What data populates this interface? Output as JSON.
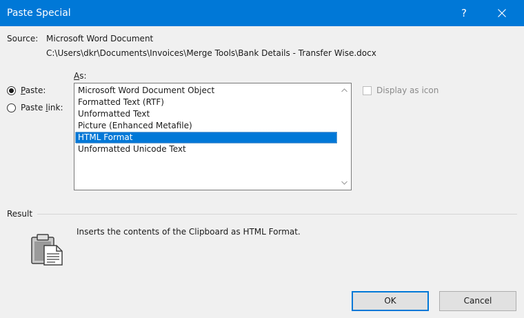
{
  "window": {
    "title": "Paste Special",
    "help_label": "?"
  },
  "source": {
    "label": "Source:",
    "value": "Microsoft Word Document",
    "path": "C:\\Users\\dkr\\Documents\\Invoices\\Merge Tools\\Bank Details - Transfer Wise.docx"
  },
  "as_label": {
    "accel": "A",
    "rest": "s:"
  },
  "options": {
    "paste": {
      "accel": "P",
      "rest": "aste:",
      "selected": true
    },
    "paste_link": {
      "pre": "Paste ",
      "accel": "l",
      "rest": "ink:",
      "selected": false
    }
  },
  "list": {
    "items": [
      "Microsoft Word Document Object",
      "Formatted Text (RTF)",
      "Unformatted Text",
      "Picture (Enhanced Metafile)",
      "HTML Format",
      "Unformatted Unicode Text"
    ],
    "selected_index": 4
  },
  "display_as_icon": {
    "label": "Display as icon",
    "checked": false,
    "enabled": false
  },
  "result": {
    "label": "Result",
    "text": "Inserts the contents of the Clipboard as HTML Format.",
    "icon": "clipboard-paste-icon"
  },
  "buttons": {
    "ok": "OK",
    "cancel": "Cancel"
  },
  "colors": {
    "accent": "#0078d7",
    "background": "#f0f0f0"
  }
}
